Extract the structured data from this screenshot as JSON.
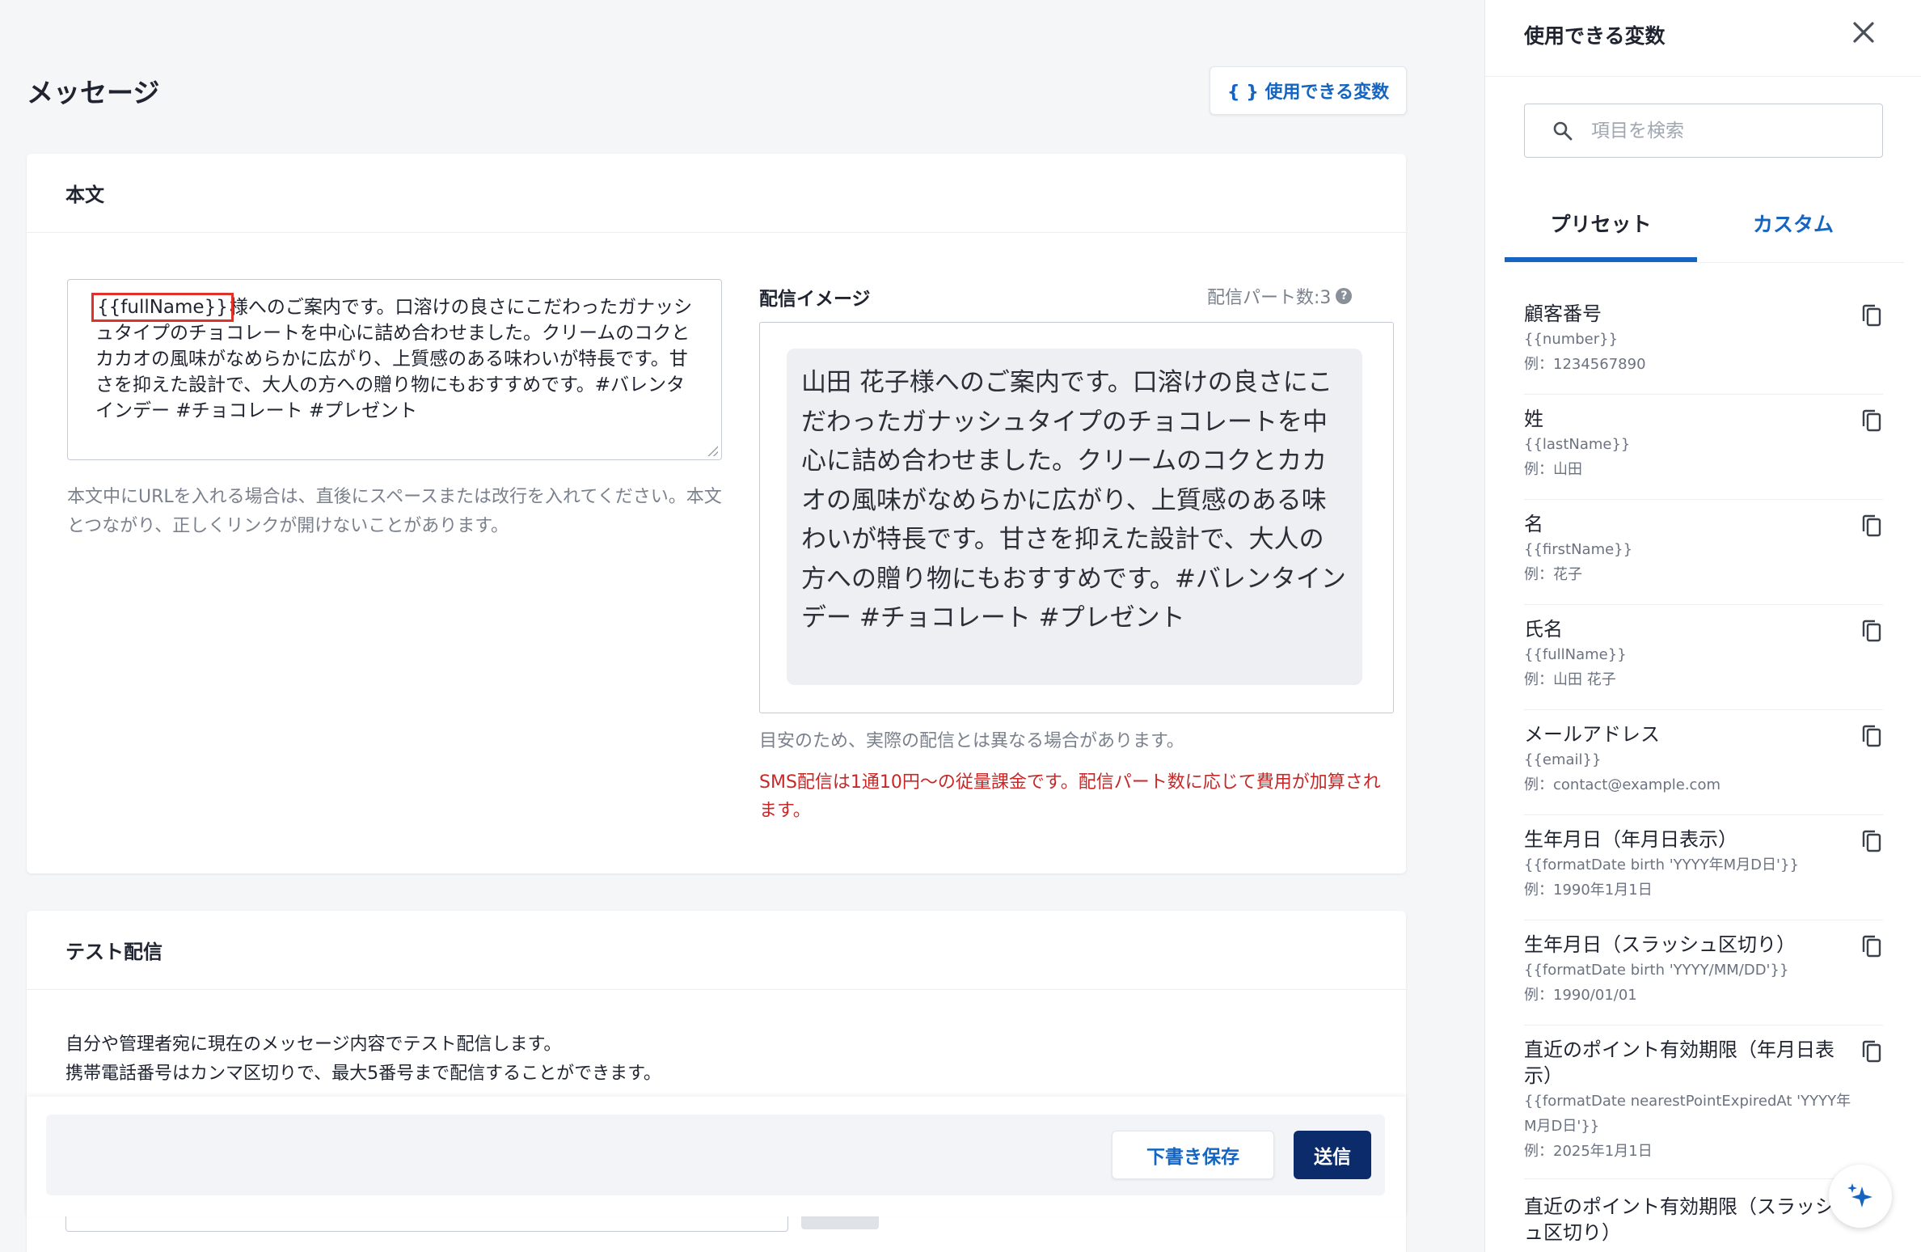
{
  "page": {
    "title": "メッセージ",
    "variables_button": "{ } 使用できる変数"
  },
  "body_card": {
    "header": "本文",
    "message_variable": "{{fullName}}",
    "message_rest": "様へのご案内です。口溶けの良さにこだわったガナッシュタイプのチョコレートを中心に詰め合わせました。クリームのコクとカカオの風味がなめらかに広がり、上質感のある味わいが特長です。甘さを抑えた設計で、大人の方への贈り物にもおすすめです。#バレンタインデー #チョコレート #プレゼント",
    "hint": "本文中にURLを入れる場合は、直後にスペースまたは改行を入れてください。本文とつながり、正しくリンクが開けないことがあります。",
    "preview_label": "配信イメージ",
    "parts_count": "配信パート数:3",
    "preview_text": "山田 花子様へのご案内です。口溶けの良さにこだわったガナッシュタイプのチョコレートを中心に詰め合わせました。クリームのコクとカカオの風味がなめらかに広がり、上質感のある味わいが特長です。甘さを抑えた設計で、大人の方への贈り物にもおすすめです。#バレンタインデー #チョコレート #プレゼント",
    "note": "目安のため、実際の配信とは異なる場合があります。",
    "warning": "SMS配信は1通10円〜の従量課金です。配信パート数に応じて費用が加算されます。"
  },
  "test_card": {
    "header": "テスト配信",
    "desc_line1": "自分や管理者宛に現在のメッセージ内容でテスト配信します。",
    "desc_line2": "携帯電話番号はカンマ区切りで、最大5番号まで配信することができます。"
  },
  "footer": {
    "draft_label": "下書き保存",
    "send_label": "送信"
  },
  "side_panel": {
    "title": "使用できる変数",
    "search_placeholder": "項目を検索",
    "tabs": [
      "プリセット",
      "カスタム"
    ],
    "items": [
      {
        "name": "顧客番号",
        "code": "{{number}}",
        "example": "例：1234567890"
      },
      {
        "name": "姓",
        "code": "{{lastName}}",
        "example": "例：山田"
      },
      {
        "name": "名",
        "code": "{{firstName}}",
        "example": "例：花子"
      },
      {
        "name": "氏名",
        "code": "{{fullName}}",
        "example": "例：山田 花子"
      },
      {
        "name": "メールアドレス",
        "code": "{{email}}",
        "example": "例：contact@example.com"
      },
      {
        "name": "生年月日（年月日表示）",
        "code": "{{formatDate birth 'YYYY年M月D日'}}",
        "example": "例：1990年1月1日"
      },
      {
        "name": "生年月日（スラッシュ区切り）",
        "code": "{{formatDate birth 'YYYY/MM/DD'}}",
        "example": "例：1990/01/01"
      },
      {
        "name": "直近のポイント有効期限（年月日表示）",
        "code": "{{formatDate nearestPointExpiredAt 'YYYY年M月D日'}}",
        "example": "例：2025年1月1日"
      },
      {
        "name": "直近のポイント有効期限（スラッシュ区切り）",
        "code": "",
        "example": ""
      }
    ]
  },
  "colors": {
    "accent": "#1565c0",
    "primary_button": "#0b2b6b",
    "warning": "#c62828",
    "highlight_box": "#e0312a"
  },
  "icons": [
    "close-icon",
    "search-icon",
    "copy-icon",
    "help-icon",
    "sparkle-icon"
  ]
}
